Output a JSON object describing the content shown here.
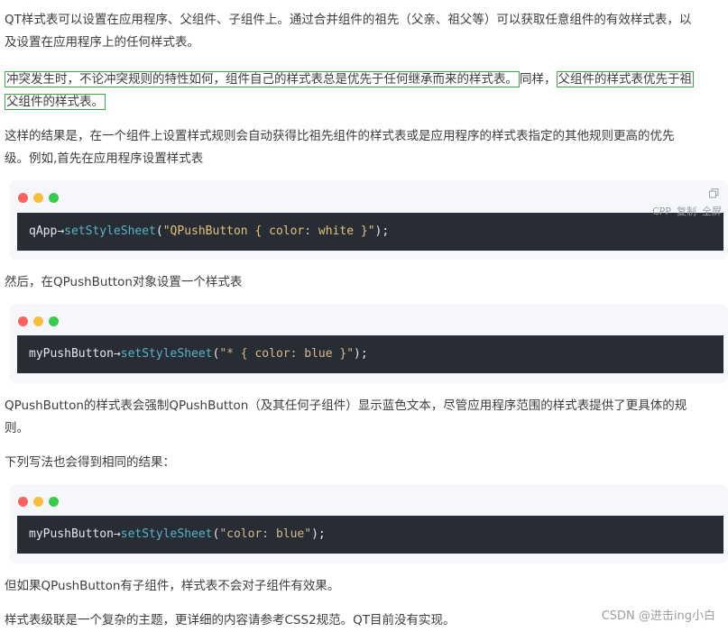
{
  "paragraphs": {
    "p1_line1": "QT样式表可以设置在应用程序、父组件、子组件上。通过合并组件的祖先（父亲、祖父等）可以获取任意组件的有效样式表，以",
    "p1_line2": "及设置在应用程序上的任何样式表。",
    "p2_line1_a": "冲突发生时，不论冲突规则的特性如何，组件自己的样式表总是优先于任何继承而来的样式表。",
    "p2_line1_b": "同样，",
    "p2_line1_c": "父组件的样式表优先于祖",
    "p2_line2": "父组件的样式表。",
    "p3_line1": "这样的结果是，在一个组件上设置样式规则会自动获得比祖先组件的样式表或是应用程序的样式表指定的其他规则更高的优先",
    "p3_line2": "级。例如,首先在应用程序设置样式表",
    "p4": "然后，在QPushButton对象设置一个样式表",
    "p5_line1": "QPushButton的样式表会强制QPushButton（及其任何子组件）显示蓝色文本，尽管应用程序范围的样式表提供了更具体的规",
    "p5_line2": "则。",
    "p6": "下列写法也会得到相同的结果：",
    "p7": "但如果QPushButton有子组件，样式表不会对子组件有效果。",
    "p8": "样式表级联是一个复杂的主题，更详细的内容请参考CSS2规范。QT目前没有实现。"
  },
  "code_blocks": [
    {
      "obj": "qApp",
      "arrow": "→",
      "method": "setStyleSheet",
      "open": "(",
      "string": "\"QPushButton { color: white }\"",
      "close": ");"
    },
    {
      "obj": "myPushButton",
      "arrow": "→",
      "method": "setStyleSheet",
      "open": "(",
      "string": "\"* { color: blue }\"",
      "close": ");"
    },
    {
      "obj": "myPushButton",
      "arrow": "→",
      "method": "setStyleSheet",
      "open": "(",
      "string": "\"color: blue\"",
      "close": ");"
    }
  ],
  "code_toolbar": {
    "lang": "CPP",
    "copy": "复制",
    "fullscreen": "全屏"
  },
  "watermark": "CSDN @进击ing小白"
}
